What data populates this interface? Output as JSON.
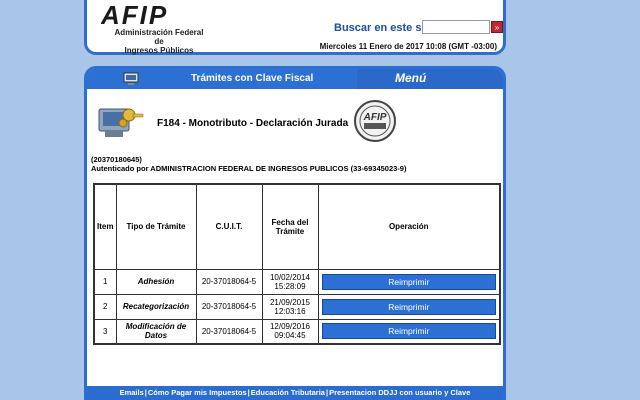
{
  "header": {
    "logo_text": "AFIP",
    "org_line1": "Administración Federal de",
    "org_line2": "Ingresos Públicos",
    "search_label": "Buscar en este sitio",
    "search_value": "",
    "search_button": "»",
    "date": "Miercoles 11 Enero de 2017 10:08 (GMT -03:00)"
  },
  "nav": {
    "title": "Trámites con Clave Fiscal",
    "menu": "Menú"
  },
  "form": {
    "title": "F184 - Monotributo - Declaración Jurada",
    "stamp_text": "AFIP",
    "cuit": "(20370180645)",
    "authenticated": "Autenticado por ADMINISTRACION FEDERAL DE INGRESOS PUBLICOS (33-69345023-9)"
  },
  "table": {
    "headers": {
      "item": "Item",
      "tipo": "Tipo de Trámite",
      "cuit": "C.U.I.T.",
      "fecha": "Fecha del Trámite",
      "operacion": "Operación"
    },
    "rows": [
      {
        "item": "1",
        "tipo": "Adhesión",
        "cuit": "20-37018064-5",
        "fecha": "10/02/2014 15:28:09",
        "operacion": "Reimprimir"
      },
      {
        "item": "2",
        "tipo": "Recategorización",
        "cuit": "20-37018064-5",
        "fecha": "21/09/2015 12:03:16",
        "operacion": "Reimprimir"
      },
      {
        "item": "3",
        "tipo": "Modificación de Datos",
        "cuit": "20-37018064-5",
        "fecha": "12/09/2016 09:04:45",
        "operacion": "Reimprimir"
      }
    ]
  },
  "footer": {
    "links": [
      "Emails",
      "Cómo Pagar mis Impuestos",
      "Educación Tributaria",
      "Presentacion DDJJ con usuario y Clave"
    ]
  },
  "colors": {
    "background": "#a9c6e8",
    "accent_blue": "#2c70d4",
    "search_button": "#c0282d"
  }
}
